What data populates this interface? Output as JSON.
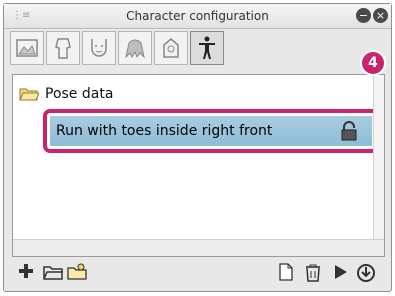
{
  "window": {
    "title": "Character configuration",
    "grip_icon": "panel-menu-icon",
    "minimize_icon": "minimize-icon",
    "close_icon": "close-icon"
  },
  "tabs": [
    {
      "name": "tab-background",
      "icon": "background-icon",
      "active": false
    },
    {
      "name": "tab-body",
      "icon": "body-icon",
      "active": false
    },
    {
      "name": "tab-face",
      "icon": "face-icon",
      "active": false
    },
    {
      "name": "tab-hair",
      "icon": "hair-icon",
      "active": false
    },
    {
      "name": "tab-accessory",
      "icon": "accessory-icon",
      "active": false
    },
    {
      "name": "tab-pose",
      "icon": "pose-icon",
      "active": true
    }
  ],
  "tree": {
    "folder_label": "Pose data",
    "selected_item_label": "Run with toes inside right front"
  },
  "callout": {
    "number": "4",
    "color": "#c7256e"
  },
  "toolbar": {
    "left_icons": [
      "add-icon",
      "new-folder-icon",
      "import-folder-icon"
    ],
    "right_icons": [
      "document-icon",
      "trash-icon",
      "play-icon",
      "apply-icon"
    ]
  }
}
